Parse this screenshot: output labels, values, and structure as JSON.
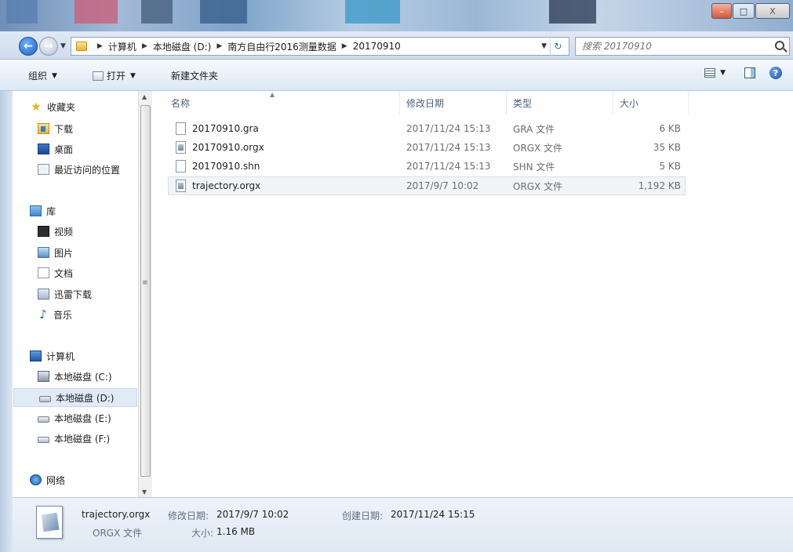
{
  "window": {
    "min_label": "–",
    "max_label": "□",
    "close_label": "X"
  },
  "address": {
    "crumbs": [
      "计算机",
      "本地磁盘 (D:)",
      "南方自由行2016测量数据",
      "20170910"
    ],
    "search_placeholder": "搜索 20170910"
  },
  "toolbar": {
    "organize": "组织",
    "open": "打开",
    "new_folder": "新建文件夹"
  },
  "nav": {
    "favorites": "收藏夹",
    "downloads": "下载",
    "desktop": "桌面",
    "recent": "最近访问的位置",
    "libraries": "库",
    "videos": "视频",
    "pictures": "图片",
    "documents": "文档",
    "xunlei": "迅雷下载",
    "music": "音乐",
    "computer": "计算机",
    "disk_c": "本地磁盘 (C:)",
    "disk_d": "本地磁盘 (D:)",
    "disk_e": "本地磁盘 (E:)",
    "disk_f": "本地磁盘 (F:)",
    "network": "网络"
  },
  "columns": {
    "name": "名称",
    "modified": "修改日期",
    "type": "类型",
    "size": "大小"
  },
  "files": [
    {
      "name": "20170910.gra",
      "modified": "2017/11/24 15:13",
      "type": "GRA 文件",
      "size": "6 KB",
      "icon": "blank-file-icon"
    },
    {
      "name": "20170910.orgx",
      "modified": "2017/11/24 15:13",
      "type": "ORGX 文件",
      "size": "35 KB",
      "icon": "orgx-file-icon"
    },
    {
      "name": "20170910.shn",
      "modified": "2017/11/24 15:13",
      "type": "SHN 文件",
      "size": "5 KB",
      "icon": "blank-file-icon"
    },
    {
      "name": "trajectory.orgx",
      "modified": "2017/9/7 10:02",
      "type": "ORGX 文件",
      "size": "1,192 KB",
      "icon": "orgx-file-icon"
    }
  ],
  "details": {
    "filename": "trajectory.orgx",
    "filetype": "ORGX 文件",
    "modified_label": "修改日期:",
    "modified_value": "2017/9/7 10:02",
    "size_label": "大小:",
    "size_value": "1.16 MB",
    "created_label": "创建日期:",
    "created_value": "2017/11/24 15:15"
  }
}
